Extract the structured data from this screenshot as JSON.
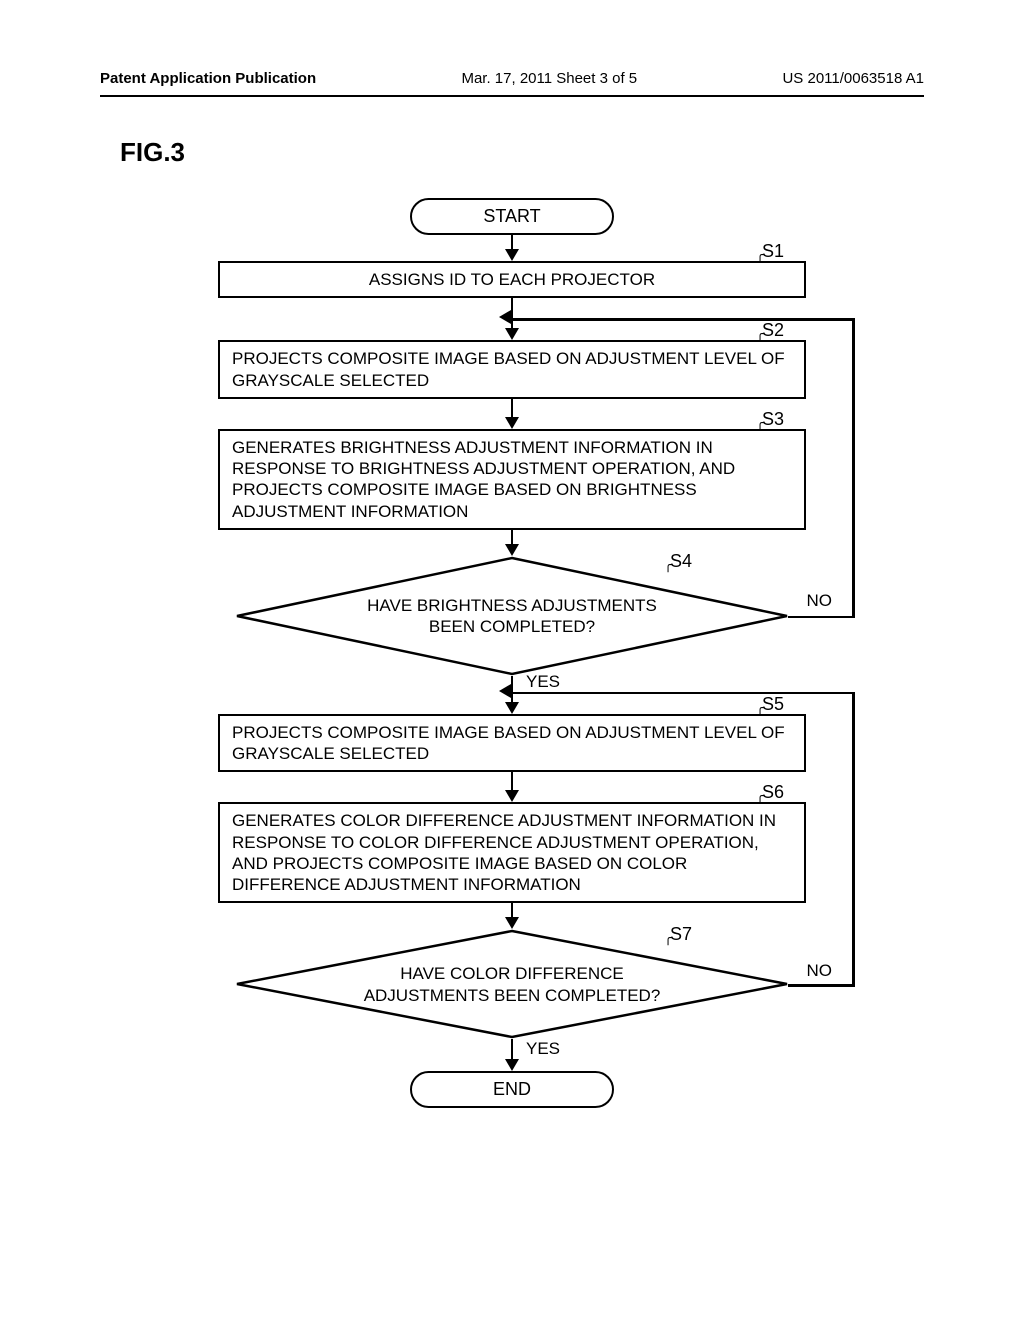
{
  "header": {
    "left": "Patent Application Publication",
    "center": "Mar. 17, 2011  Sheet 3 of 5",
    "right": "US 2011/0063518 A1"
  },
  "figure_label": "FIG.3",
  "flow": {
    "start": "START",
    "end": "END",
    "s1": {
      "label": "S1",
      "text": "ASSIGNS ID TO EACH PROJECTOR"
    },
    "s2": {
      "label": "S2",
      "text": "PROJECTS COMPOSITE IMAGE BASED ON ADJUSTMENT LEVEL OF GRAYSCALE SELECTED"
    },
    "s3": {
      "label": "S3",
      "text": "GENERATES BRIGHTNESS ADJUSTMENT INFORMATION IN RESPONSE TO BRIGHTNESS ADJUSTMENT OPERATION, AND PROJECTS COMPOSITE IMAGE BASED ON BRIGHTNESS ADJUSTMENT INFORMATION"
    },
    "s4": {
      "label": "S4",
      "text": "HAVE BRIGHTNESS ADJUSTMENTS BEEN COMPLETED?",
      "yes": "YES",
      "no": "NO"
    },
    "s5": {
      "label": "S5",
      "text": "PROJECTS COMPOSITE IMAGE BASED ON ADJUSTMENT LEVEL OF GRAYSCALE SELECTED"
    },
    "s6": {
      "label": "S6",
      "text": "GENERATES COLOR DIFFERENCE ADJUSTMENT INFORMATION IN RESPONSE TO COLOR DIFFERENCE ADJUSTMENT OPERATION, AND PROJECTS COMPOSITE IMAGE BASED ON COLOR DIFFERENCE ADJUSTMENT INFORMATION"
    },
    "s7": {
      "label": "S7",
      "text": "HAVE COLOR DIFFERENCE ADJUSTMENTS BEEN COMPLETED?",
      "yes": "YES",
      "no": "NO"
    }
  }
}
